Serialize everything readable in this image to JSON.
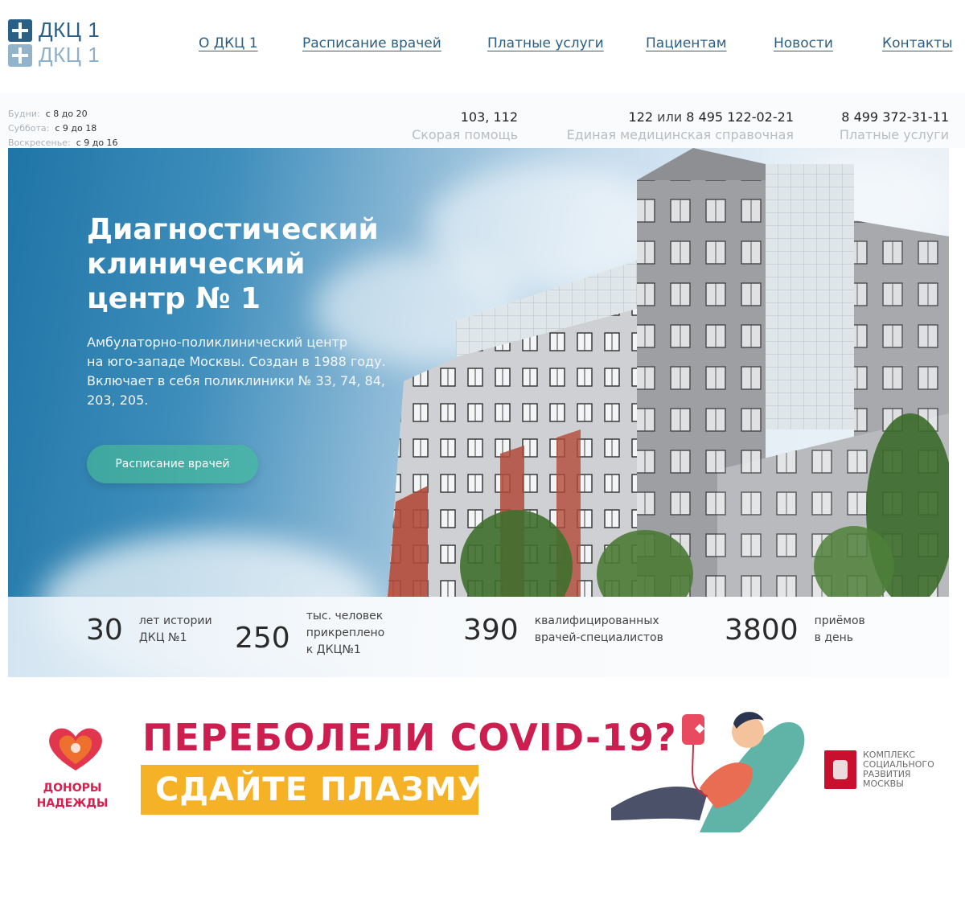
{
  "header": {
    "logo_text": "ДКЦ 1",
    "nav": [
      "О ДКЦ 1",
      "Расписание врачей",
      "Платные услуги",
      "Пациентам",
      "Новости",
      "Контакты"
    ]
  },
  "hours": [
    {
      "label": "Будни:",
      "value": "с 8 до 20"
    },
    {
      "label": "Суббота:",
      "value": "с 9 до 18"
    },
    {
      "label": "Воскресенье:",
      "value": "с 9 до 16"
    }
  ],
  "phones": [
    {
      "number": "103, 112",
      "caption": "Скорая помощь"
    },
    {
      "number_a": "122",
      "or": "или",
      "number_b": "8 495 122-02-21",
      "caption": "Единая медицинская справочная"
    },
    {
      "number": "8 499 372-31-11",
      "caption": "Платные услуги"
    }
  ],
  "hero": {
    "title_lines": [
      "Диагностический",
      "клинический",
      "центр № 1"
    ],
    "desc_lines": [
      "Амбулаторно-поликлинический центр",
      "на юго-западе Москвы. Создан в 1988 году.",
      "Включает в себя поликлиники № 33, 74, 84,",
      "203, 205."
    ],
    "button_label": "Расписание врачей"
  },
  "stats": [
    {
      "value": "30",
      "lines": [
        "лет истории",
        "ДКЦ №1"
      ]
    },
    {
      "value": "250",
      "lines": [
        "тыс. человек",
        "прикреплено",
        "к ДКЦ№1"
      ]
    },
    {
      "value": "390",
      "lines": [
        "квалифицированных",
        "врачей-специалистов"
      ]
    },
    {
      "value": "3800",
      "lines": [
        "приёмов",
        "в день"
      ]
    }
  ],
  "banner": {
    "donor_lines": [
      "ДОНОРЫ",
      "НАДЕЖДЫ"
    ],
    "headline": "ПЕРЕБОЛЕЛИ COVID-19?",
    "cta": "СДАЙТЕ ПЛАЗМУ",
    "mos_lines": [
      "КОМПЛЕКС",
      "СОЦИАЛЬНОГО",
      "РАЗВИТИЯ",
      "МОСКВЫ"
    ]
  },
  "colors": {
    "brand": "#2a5f86",
    "button": "#45ada4",
    "covid_red": "#cc1f4f",
    "plasma_yellow": "#f6b227"
  }
}
